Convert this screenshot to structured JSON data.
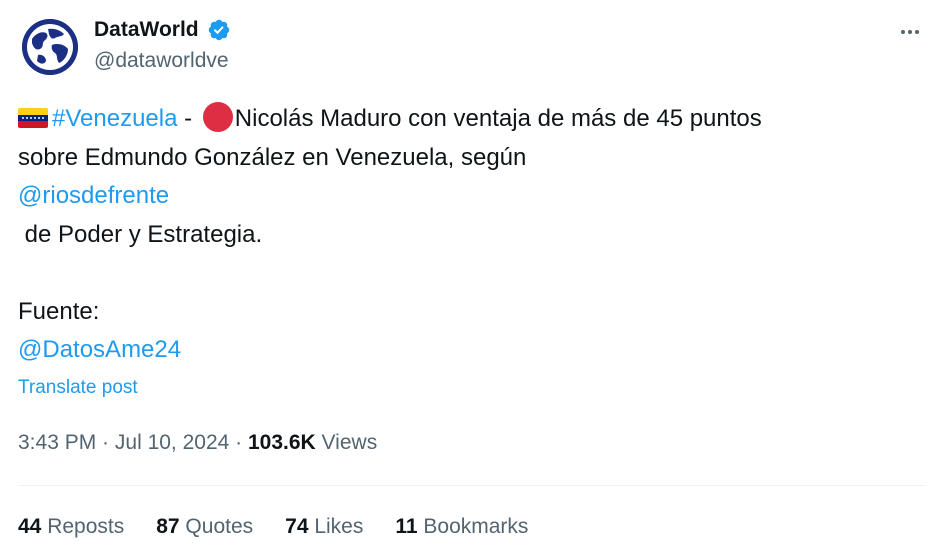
{
  "author": {
    "display_name": "DataWorld",
    "handle": "@dataworldve",
    "verified": true,
    "avatar_icon": "globe-icon"
  },
  "tweet": {
    "hashtag": "#Venezuela",
    "line1_after_hashtag": " - ",
    "line1_rest": "Nicolás Maduro con ventaja de más de 45 puntos",
    "line2": "sobre Edmundo González en Venezuela, según",
    "mention1": "@riosdefrente",
    "line4": " de Poder y Estrategia.",
    "line6": "Fuente:",
    "mention2": "@DatosAme24"
  },
  "translate_label": "Translate post",
  "meta": {
    "time": "3:43 PM",
    "separator": " · ",
    "date": "Jul 10, 2024",
    "views_count": "103.6K",
    "views_label": " Views"
  },
  "stats": {
    "reposts_count": "44",
    "reposts_label": " Reposts",
    "quotes_count": "87",
    "quotes_label": " Quotes",
    "likes_count": "74",
    "likes_label": " Likes",
    "bookmarks_count": "11",
    "bookmarks_label": " Bookmarks"
  },
  "colors": {
    "link": "#1d9bf0",
    "secondary_text": "#536471",
    "primary_text": "#0f1419",
    "verified": "#1d9bf0",
    "red_circle": "#dd2e44"
  }
}
